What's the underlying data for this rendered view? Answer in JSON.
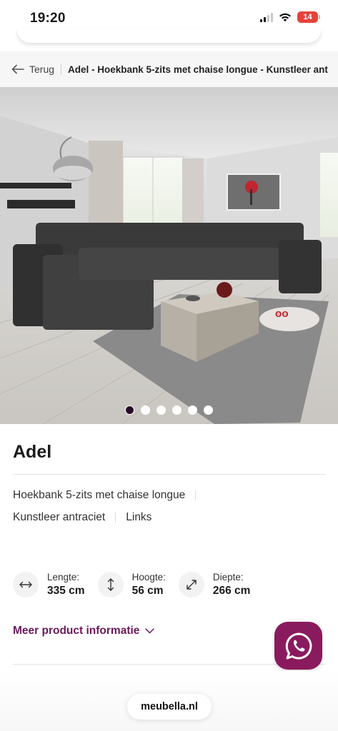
{
  "status_bar": {
    "time": "19:20",
    "battery": "14"
  },
  "breadcrumb": {
    "back_label": "Terug",
    "title": "Adel - Hoekbank 5-zits met chaise longue - Kunstleer ant"
  },
  "gallery": {
    "image_count": 6,
    "active_index": 0
  },
  "product": {
    "name": "Adel",
    "attributes_row1": [
      "Hoekbank 5-zits met chaise longue"
    ],
    "attributes_row2": [
      "Kunstleer antraciet",
      "Links"
    ]
  },
  "dimensions": [
    {
      "icon": "arrows-horizontal-icon",
      "label": "Lengte:",
      "value": "335 cm"
    },
    {
      "icon": "arrows-vertical-icon",
      "label": "Hoogte:",
      "value": "56 cm"
    },
    {
      "icon": "arrows-diagonal-icon",
      "label": "Diepte:",
      "value": "266 cm"
    }
  ],
  "more_info_label": "Meer product informatie",
  "browser": {
    "domain": "meubella.nl"
  },
  "colors": {
    "accent": "#6b1a5b",
    "whatsapp_bg": "#8a1a5e",
    "battery": "#e5423c"
  }
}
